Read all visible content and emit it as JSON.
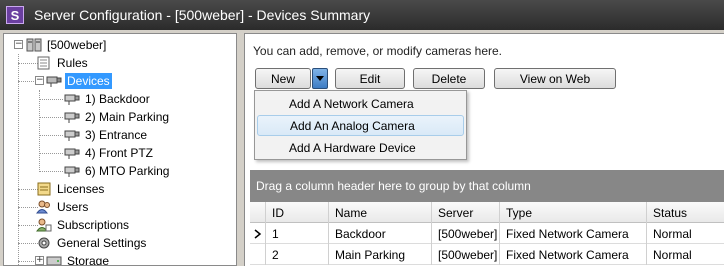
{
  "window": {
    "title": "Server Configuration - [500weber] - Devices Summary",
    "app_icon": "S"
  },
  "tree": {
    "root": "[500weber]",
    "items": [
      {
        "label": "Rules",
        "icon": "rules-icon"
      },
      {
        "label": "Devices",
        "icon": "devices-icon",
        "selected": true
      },
      {
        "label": "1) Backdoor",
        "icon": "camera-icon"
      },
      {
        "label": "2) Main Parking",
        "icon": "camera-icon"
      },
      {
        "label": "3) Entrance",
        "icon": "camera-icon"
      },
      {
        "label": "4) Front PTZ",
        "icon": "camera-icon"
      },
      {
        "label": "6) MTO Parking",
        "icon": "camera-icon"
      },
      {
        "label": "Licenses",
        "icon": "licenses-icon"
      },
      {
        "label": "Users",
        "icon": "users-icon"
      },
      {
        "label": "Subscriptions",
        "icon": "subscriptions-icon"
      },
      {
        "label": "General Settings",
        "icon": "settings-icon"
      },
      {
        "label": "Storage",
        "icon": "storage-icon"
      }
    ]
  },
  "main": {
    "description": "You can add, remove, or modify cameras here.",
    "toolbar": {
      "new": "New",
      "edit": "Edit",
      "delete": "Delete",
      "view_on_web": "View on Web"
    },
    "new_menu": [
      "Add A Network Camera",
      "Add An Analog Camera",
      "Add A Hardware Device"
    ],
    "new_menu_hover": "Add An Analog Camera",
    "group_hint": "Drag a column header here to group by that column",
    "columns": [
      "ID",
      "Name",
      "Server",
      "Type",
      "Status"
    ],
    "rows": [
      [
        "1",
        "Backdoor",
        "[500weber]",
        "Fixed Network Camera",
        "Normal"
      ],
      [
        "2",
        "Main Parking",
        "[500weber]",
        "Fixed Network Camera",
        "Normal"
      ]
    ]
  },
  "colors": {
    "selection": "#3399ff",
    "titlebar": "#2b2b2b",
    "group_bar": "#878787"
  }
}
